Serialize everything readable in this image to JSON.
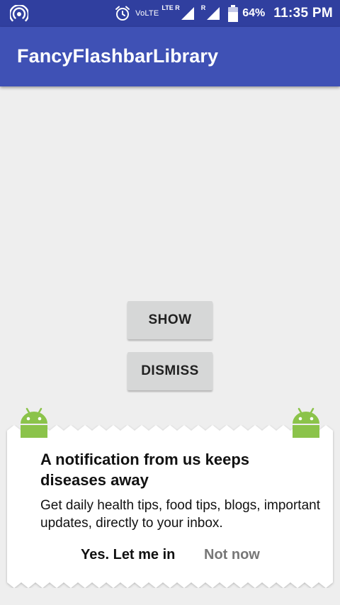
{
  "status_bar": {
    "volte": "VoLTE",
    "lte_tag": "LTE R",
    "roaming_tag": "R",
    "battery": "64%",
    "time": "11:35 PM",
    "icons": [
      "hotspot-icon",
      "alarm-icon",
      "signal-icon",
      "battery-icon"
    ]
  },
  "app_bar": {
    "title": "FancyFlashbarLibrary"
  },
  "buttons": {
    "show": "SHOW",
    "dismiss": "DISMISS"
  },
  "flashbar": {
    "title": "A notification from us keeps diseases away",
    "message": "Get daily health tips, food tips, blogs, important updates, directly to your inbox.",
    "positive_action": "Yes. Let me in",
    "negative_action": "Not now"
  },
  "colors": {
    "status_bar": "#303f9f",
    "app_bar": "#3f51b5",
    "background": "#eeeeee",
    "button": "#d6d7d7",
    "android_green": "#8bc34a",
    "negative_action": "#777777"
  }
}
